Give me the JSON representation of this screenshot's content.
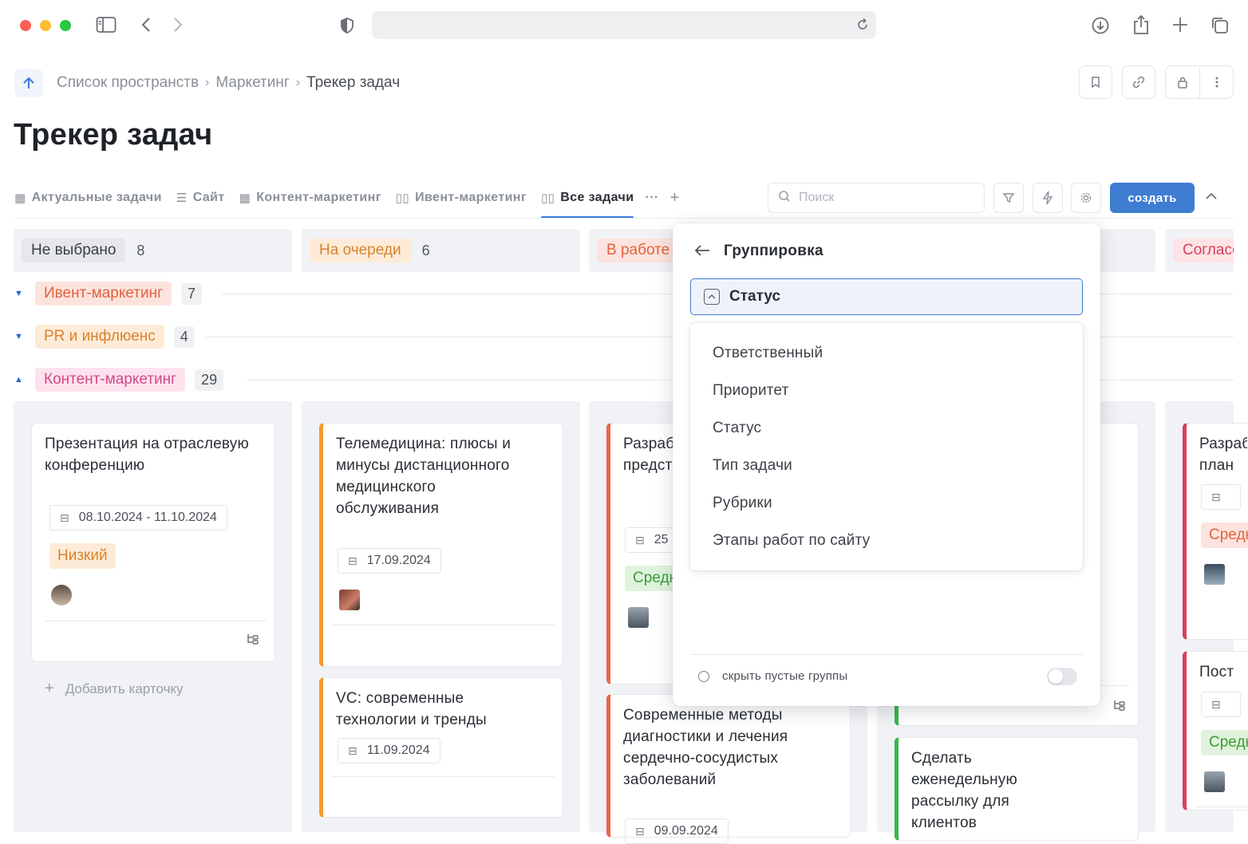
{
  "browser": {
    "traffic_colors": [
      "#ff5f57",
      "#febc2e",
      "#28c840"
    ],
    "icons": [
      "sidebar-icon",
      "back-icon",
      "forward-icon",
      "shield-icon",
      "reload-icon",
      "download-icon",
      "share-icon",
      "new-tab-icon",
      "tabs-icon"
    ]
  },
  "breadcrumb": {
    "items": [
      "Список пространств",
      "Маркетинг",
      "Трекер задач"
    ],
    "separator": "›"
  },
  "page": {
    "title": "Трекер задач"
  },
  "views": [
    {
      "label": "Актуальные задачи",
      "icon": "table-icon"
    },
    {
      "label": "Сайт",
      "icon": "list-icon"
    },
    {
      "label": "Контент-маркетинг",
      "icon": "table-icon"
    },
    {
      "label": "Ивент-маркетинг",
      "icon": "kanban-icon"
    },
    {
      "label": "Все задачи",
      "icon": "kanban-icon",
      "active": true
    }
  ],
  "views_more": "···",
  "views_add": "+",
  "search": {
    "placeholder": "Поиск"
  },
  "toolbar": {
    "create_label": "создать"
  },
  "columns": [
    {
      "label": "Не выбрано",
      "count": "8",
      "bg": "#e6e7ea",
      "fg": "#3a3f46"
    },
    {
      "label": "На очереди",
      "count": "6",
      "bg": "#fdebd8",
      "fg": "#d9822b"
    },
    {
      "label": "В работе",
      "count": "",
      "bg": "#fde3dd",
      "fg": "#e0623f"
    },
    {
      "label": "Согласование",
      "count": "",
      "bg": "#fde3e6",
      "fg": "#d8405a"
    }
  ],
  "swimlanes": [
    {
      "label": "Ивент-маркетинг",
      "count": "7",
      "expanded": false,
      "bg": "#fde3dd",
      "fg": "#e0623f"
    },
    {
      "label": "PR и инфлюенс",
      "count": "4",
      "expanded": false,
      "bg": "#fdebd8",
      "fg": "#d9822b"
    },
    {
      "label": "Контент-маркетинг",
      "count": "29",
      "expanded": true,
      "bg": "#fde2ee",
      "fg": "#d14a86"
    }
  ],
  "cards": {
    "c1": {
      "title": "Презентация на отраслевую конференцию",
      "date": "08.10.2024 - 11.10.2024",
      "priority": "Низкий"
    },
    "c2": {
      "title": "Телемедицина: плюсы и минусы дистанционного медицинского обслуживания",
      "date": "17.09.2024"
    },
    "c3": {
      "title": "VC: современные технологии и тренды",
      "date": "11.09.2024"
    },
    "c4": {
      "title": "Разработка и материалов представления вебинара",
      "date": "25",
      "priority": "Средний"
    },
    "c5": {
      "title": "Современные методы диагностики и лечения сердечно-сосудистых заболеваний",
      "date": "09.09.2024"
    },
    "c6": {
      "title": "Сделать еженедельную рассылку для клиентов"
    },
    "c7": {
      "title": "Разработка план",
      "priority": "Средний"
    },
    "c8": {
      "title": "Пост",
      "priority": "Средний"
    }
  },
  "add_card_label": "Добавить карточку",
  "grouping_popup": {
    "title": "Группировка",
    "selected": "Статус",
    "options": [
      "Ответственный",
      "Приоритет",
      "Статус",
      "Тип задачи",
      "Рубрики",
      "Этапы работ по сайту"
    ],
    "hide_empty_label": "скрыть пустые группы",
    "hide_empty_enabled": false
  },
  "colors": {
    "accent": "#3f7dd3",
    "bar_orange": "#f29a2e",
    "bar_red": "#e8664a",
    "bar_green": "#3bb54a",
    "bar_crimson": "#d8405a",
    "prio_low_bg": "#fdebd8",
    "prio_low_fg": "#d9822b",
    "prio_mid_bg": "#dff3dc",
    "prio_mid_fg": "#3e9a3a"
  }
}
